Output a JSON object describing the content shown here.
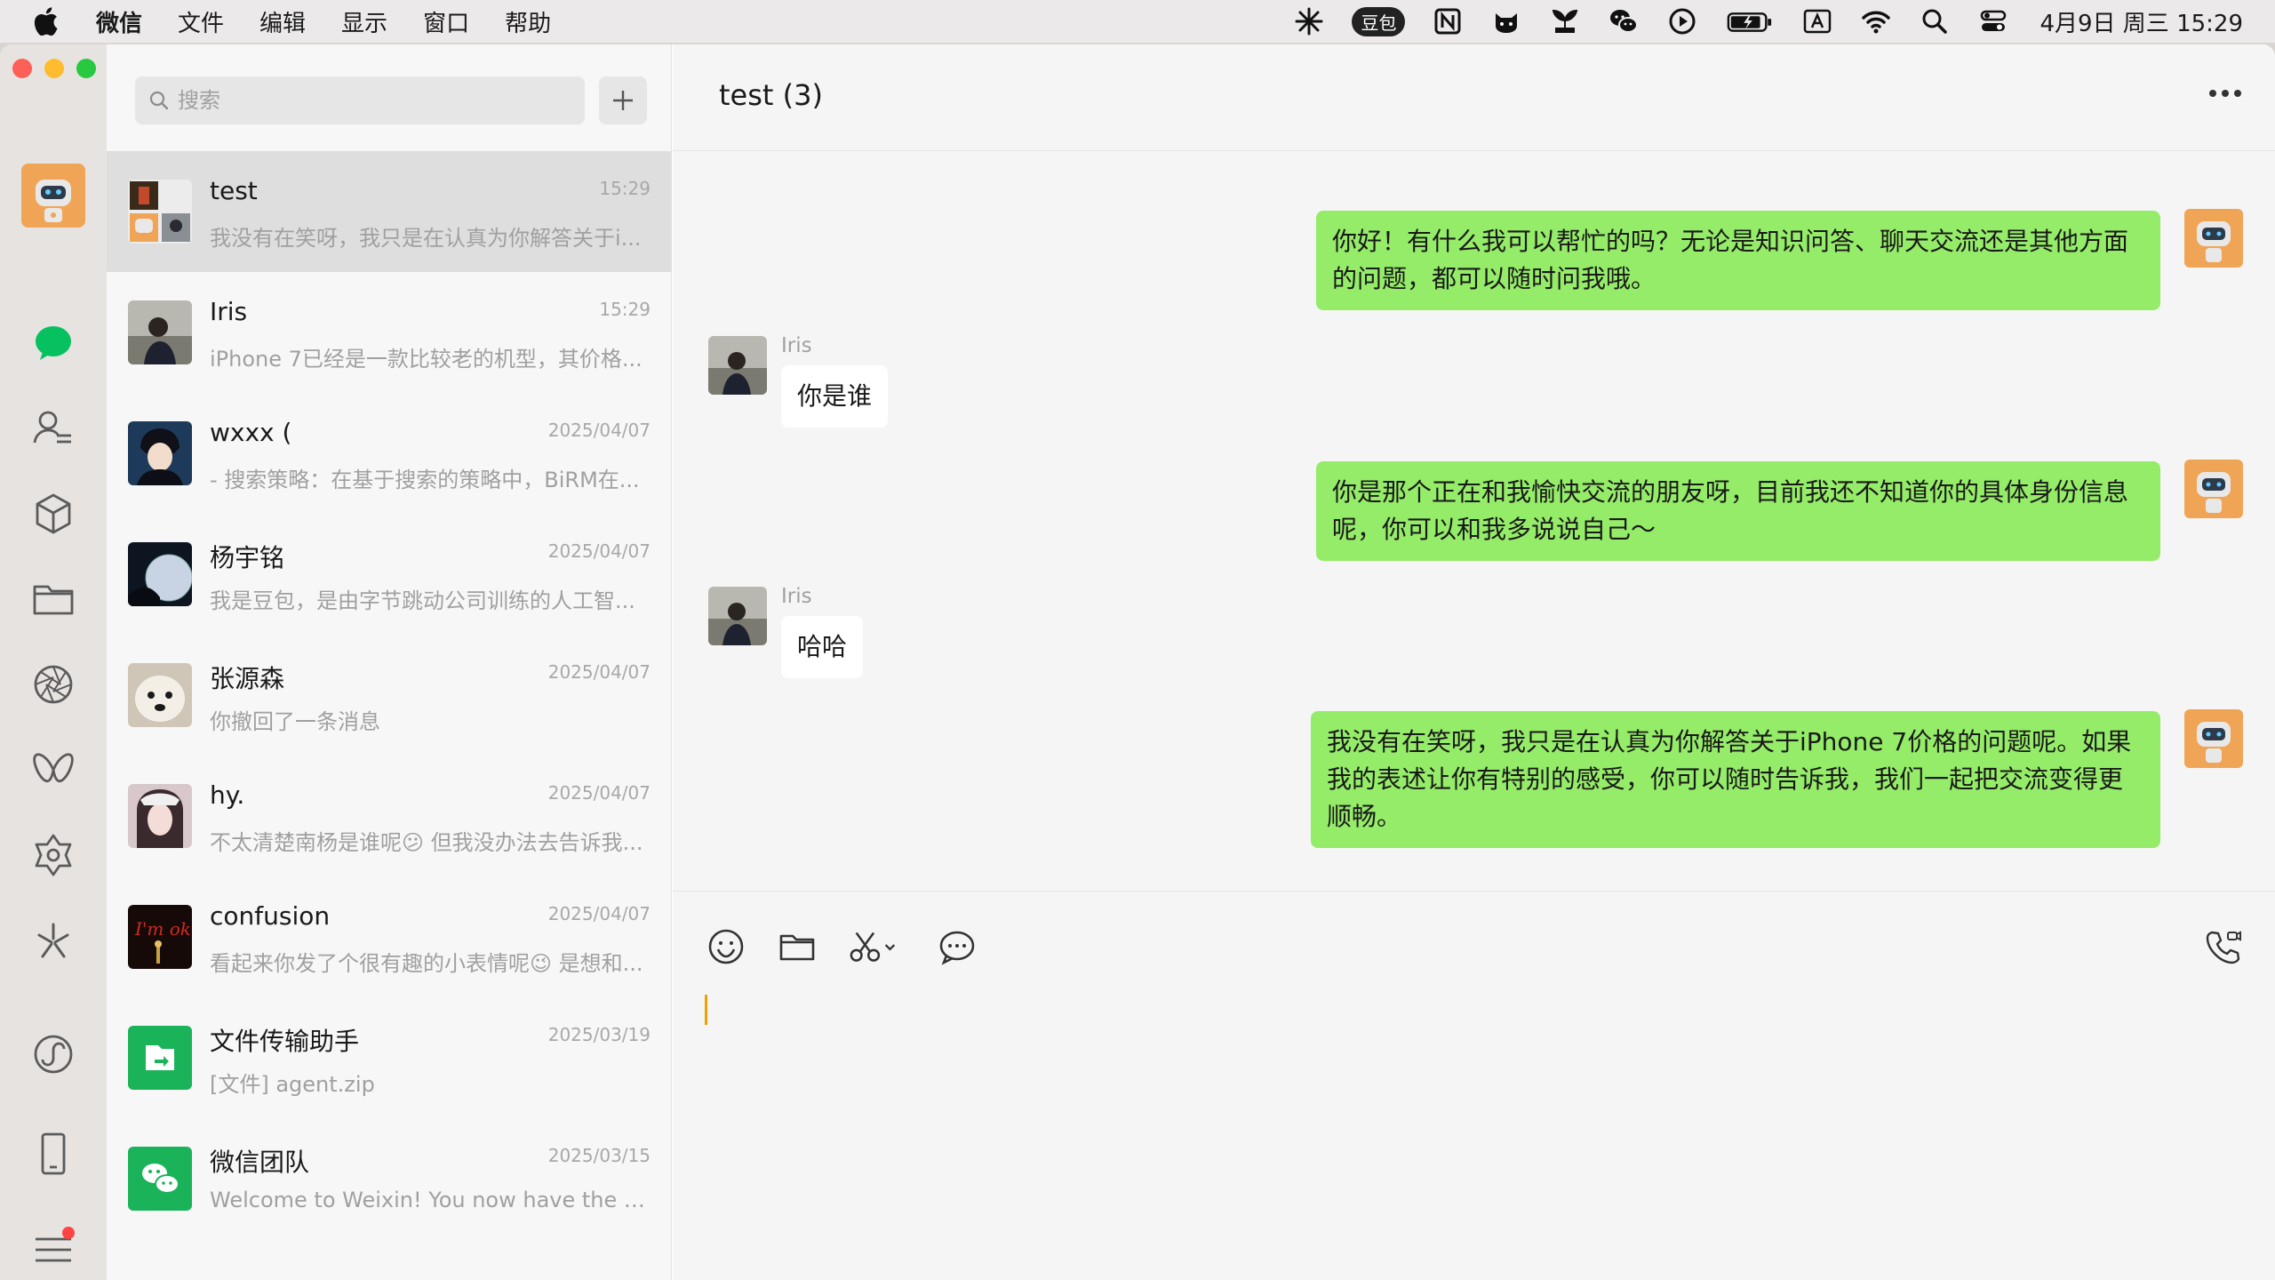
{
  "menubar": {
    "app_name": "微信",
    "menus": [
      "文件",
      "编辑",
      "显示",
      "窗口",
      "帮助"
    ],
    "doubao_badge": "豆包",
    "datetime": "4月9日 周三  15:29"
  },
  "search": {
    "placeholder": "搜索"
  },
  "conversations": [
    {
      "name": "test",
      "time": "15:29",
      "preview": "我没有在笑呀，我只是在认真为你解答关于i...",
      "active": true
    },
    {
      "name": "Iris",
      "time": "15:29",
      "preview": "iPhone 7已经是一款比较老的机型，其价格..."
    },
    {
      "name": "wxxx (",
      "time": "2025/04/07",
      "preview": "- 搜索策略：在基于搜索的策略中，BiRM在..."
    },
    {
      "name": "杨宇铭",
      "time": "2025/04/07",
      "preview": "我是豆包，是由字节跳动公司训练的人工智..."
    },
    {
      "name": "张源森",
      "time": "2025/04/07",
      "preview": "你撤回了一条消息"
    },
    {
      "name": "hy.",
      "time": "2025/04/07",
      "preview": "不太清楚南杨是谁呢😕 但我没办法去告诉我..."
    },
    {
      "name": "confusion",
      "time": "2025/04/07",
      "preview": "看起来你发了个很有趣的小表情呢😉 是想和..."
    },
    {
      "name": "文件传输助手",
      "time": "2025/03/19",
      "preview": "[文件] agent.zip"
    },
    {
      "name": "微信团队",
      "time": "2025/03/15",
      "preview": "Welcome to Weixin! You now have the mos..."
    }
  ],
  "chat": {
    "title": "test  (3)",
    "messages": [
      {
        "from": "me",
        "text": "你好！有什么我可以帮忙的吗？无论是知识问答、聊天交流还是其他方面的问题，都可以随时问我哦。"
      },
      {
        "from": "Iris",
        "sender": "Iris",
        "text": "你是谁"
      },
      {
        "from": "me",
        "text": "你是那个正在和我愉快交流的朋友呀，目前我还不知道你的具体身份信息呢，你可以和我多说说自己～"
      },
      {
        "from": "Iris",
        "sender": "Iris",
        "text": "哈哈"
      },
      {
        "from": "me",
        "text": "我没有在笑呀，我只是在认真为你解答关于iPhone 7价格的问题呢。如果我的表述让你有特别的感受，你可以随时告诉我，我们一起把交流变得更顺畅。"
      }
    ]
  },
  "colors": {
    "bubble_me": "#95ec69",
    "bubble_other": "#ffffff",
    "accent_green": "#07c160",
    "caret": "#f0a000"
  }
}
